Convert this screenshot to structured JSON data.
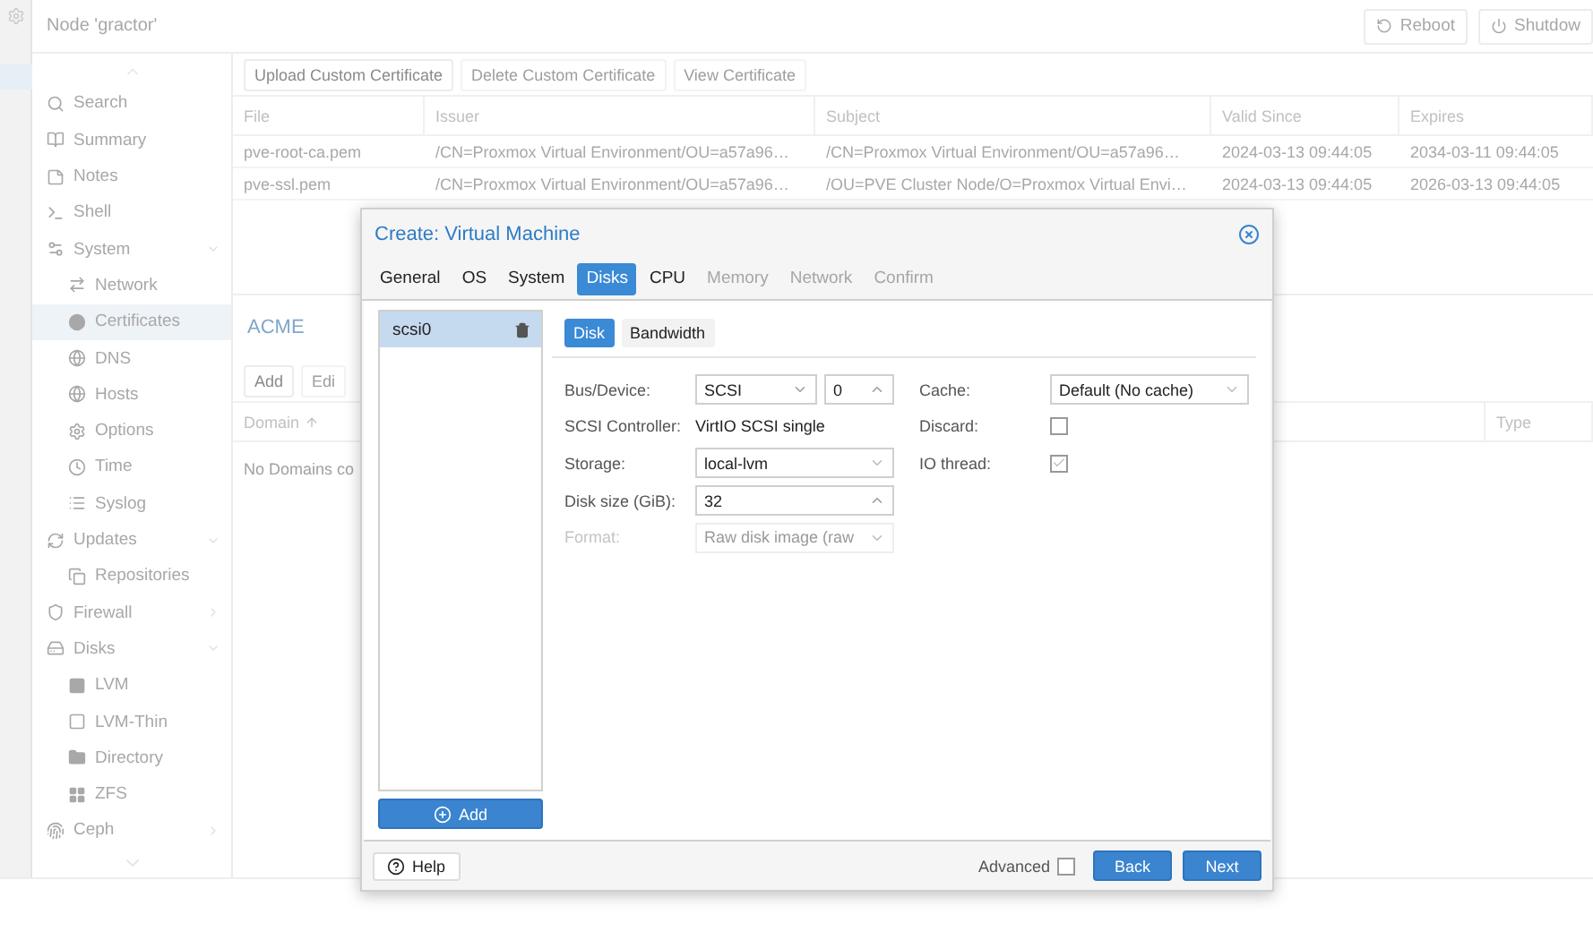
{
  "header": {
    "title": "Node 'gractor'",
    "buttons": [
      {
        "label": "Reboot",
        "kind": "reboot"
      },
      {
        "label": "Shutdow",
        "kind": "shutdown"
      }
    ]
  },
  "sidebar": {
    "items": [
      {
        "label": "Search",
        "selected": false
      },
      {
        "label": "Summary",
        "selected": false
      },
      {
        "label": "Notes",
        "selected": false
      },
      {
        "label": "Shell",
        "selected": false
      },
      {
        "label": "System",
        "selected": false,
        "expanded": true,
        "children": [
          {
            "label": "Network",
            "selected": false
          },
          {
            "label": "Certificates",
            "selected": true
          },
          {
            "label": "DNS",
            "selected": false
          },
          {
            "label": "Hosts",
            "selected": false
          },
          {
            "label": "Options",
            "selected": false
          },
          {
            "label": "Time",
            "selected": false
          },
          {
            "label": "Syslog",
            "selected": false
          }
        ]
      },
      {
        "label": "Updates",
        "selected": false,
        "expanded": true,
        "children": [
          {
            "label": "Repositories",
            "selected": false
          }
        ]
      },
      {
        "label": "Firewall",
        "selected": false,
        "expanded": false
      },
      {
        "label": "Disks",
        "selected": false,
        "expanded": true,
        "children": [
          {
            "label": "LVM",
            "selected": false
          },
          {
            "label": "LVM-Thin",
            "selected": false
          },
          {
            "label": "Directory",
            "selected": false
          },
          {
            "label": "ZFS",
            "selected": false
          }
        ]
      },
      {
        "label": "Ceph",
        "selected": false,
        "expanded": false
      }
    ]
  },
  "certificates": {
    "toolbar": [
      {
        "label": "Upload Custom Certificate",
        "disabled": false
      },
      {
        "label": "Delete Custom Certificate",
        "disabled": true
      },
      {
        "label": "View Certificate",
        "disabled": true
      }
    ],
    "columns": [
      "File",
      "Issuer",
      "Subject",
      "Valid Since",
      "Expires"
    ],
    "rows": [
      [
        "pve-root-ca.pem",
        "/CN=Proxmox Virtual Environment/OU=a57a96…",
        "/CN=Proxmox Virtual Environment/OU=a57a96…",
        "2024-03-13 09:44:05",
        "2034-03-11 09:44:05"
      ],
      [
        "pve-ssl.pem",
        "/CN=Proxmox Virtual Environment/OU=a57a96…",
        "/OU=PVE Cluster Node/O=Proxmox Virtual Envi…",
        "2024-03-13 09:44:05",
        "2026-03-13 09:44:05"
      ]
    ]
  },
  "acme": {
    "title": "ACME",
    "toolbar": [
      {
        "label": "Add",
        "disabled": false
      },
      {
        "label": "Edi",
        "disabled": true
      }
    ],
    "columns": [
      "Domain",
      "Type"
    ],
    "empty_text": "No Domains co"
  },
  "dialog": {
    "title": "Create: Virtual Machine",
    "tabs": [
      {
        "label": "General",
        "selected": false,
        "disabled": false
      },
      {
        "label": "OS",
        "selected": false,
        "disabled": false
      },
      {
        "label": "System",
        "selected": false,
        "disabled": false
      },
      {
        "label": "Disks",
        "selected": true,
        "disabled": false
      },
      {
        "label": "CPU",
        "selected": false,
        "disabled": false
      },
      {
        "label": "Memory",
        "selected": false,
        "disabled": true
      },
      {
        "label": "Network",
        "selected": false,
        "disabled": true
      },
      {
        "label": "Confirm",
        "selected": false,
        "disabled": true
      }
    ],
    "disks": [
      {
        "name": "scsi0",
        "selected": true
      }
    ],
    "add_button": "Add",
    "subtabs": [
      {
        "label": "Disk",
        "selected": true
      },
      {
        "label": "Bandwidth",
        "selected": false
      }
    ],
    "left_fields": [
      {
        "label": "Bus/Device:",
        "kind": "bus",
        "value": "SCSI",
        "number": "0",
        "disabled": false
      },
      {
        "label": "SCSI Controller:",
        "kind": "text",
        "value": "VirtIO SCSI single",
        "disabled": false
      },
      {
        "label": "Storage:",
        "kind": "select",
        "value": "local-lvm",
        "disabled": false
      },
      {
        "label": "Disk size (GiB):",
        "kind": "spinner",
        "value": "32",
        "disabled": false
      },
      {
        "label": "Format:",
        "kind": "select",
        "value": "Raw disk image (raw",
        "disabled": true
      }
    ],
    "right_fields": [
      {
        "label": "Cache:",
        "kind": "select",
        "value": "Default (No cache)"
      },
      {
        "label": "Discard:",
        "kind": "checkbox",
        "checked": false
      },
      {
        "label": "IO thread:",
        "kind": "checkbox",
        "checked": true
      }
    ],
    "help_button": "Help",
    "advanced": {
      "label": "Advanced",
      "checked": false
    },
    "buttons": [
      "Back",
      "Next"
    ]
  }
}
